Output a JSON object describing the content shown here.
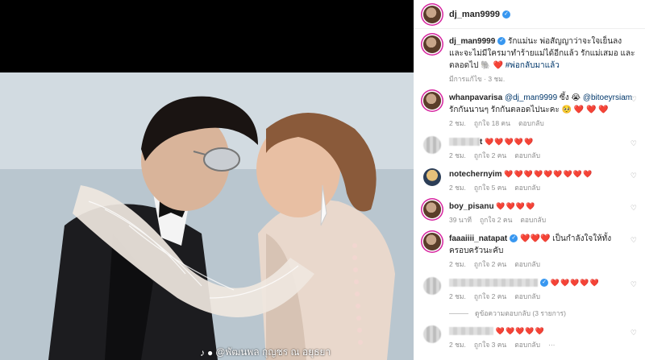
{
  "header": {
    "username": "dj_man9999"
  },
  "caption": {
    "username": "dj_man9999",
    "text": "รักแม่นะ พ่อสัญญาว่าจะใจเย็นลง และจะไม่มีใครมาทำร้ายแม่ได้อีกแล้ว รักแม่เสมอ และตลอดไป",
    "emoji": "🐘 ❤️",
    "hashtag": "#พ่อกลับมาแล้ว",
    "time": "มีการแก้ไข · 3 ชม."
  },
  "comments": [
    {
      "username": "whanpavarisa",
      "mention1": "@dj_man9999",
      "middle": "ซึ้ง 😭",
      "mention2": "@bitoeyrsiam",
      "text": "รักกันนานๆ รักกันตลอดไปนะคะ 🥺 ❤️ ❤️ ❤️",
      "time": "2 ชม.",
      "likes": "ถูกใจ 18 คน",
      "reply": "ตอบกลับ"
    },
    {
      "username": "t",
      "text": "❤️❤️❤️❤️❤️",
      "time": "2 ชม.",
      "likes": "ถูกใจ 2 คน",
      "reply": "ตอบกลับ"
    },
    {
      "username": "notechernyim",
      "text": "❤️❤️❤️❤️❤️❤️❤️❤️❤️",
      "time": "2 ชม.",
      "likes": "ถูกใจ 5 คน",
      "reply": "ตอบกลับ"
    },
    {
      "username": "boy_pisanu",
      "text": "❤️❤️❤️❤️",
      "time": "39 นาที",
      "likes": "ถูกใจ 2 คน",
      "reply": "ตอบกลับ"
    },
    {
      "username": "faaaiiii_natapat",
      "text": "❤️❤️❤️ เป็นกำลังใจให้ทั้งครอบครัวนะคับ",
      "time": "2 ชม.",
      "likes": "ถูกใจ 2 คน",
      "reply": "ตอบกลับ"
    },
    {
      "username": "",
      "text": "❤️❤️❤️❤️❤️",
      "time": "2 ชม.",
      "likes": "ถูกใจ 2 คน",
      "reply": "ตอบกลับ",
      "view_replies": "ดูข้อความตอบกลับ (3 รายการ)"
    },
    {
      "username": "",
      "text": "❤️❤️❤️❤️❤️",
      "time": "2 ชม.",
      "likes": "ถูกใจ 3 คน",
      "reply": "ตอบกลับ",
      "more": "···"
    }
  ],
  "watermark": {
    "text": "@พัฒนพล กุญชร ณ อยุธยา"
  }
}
